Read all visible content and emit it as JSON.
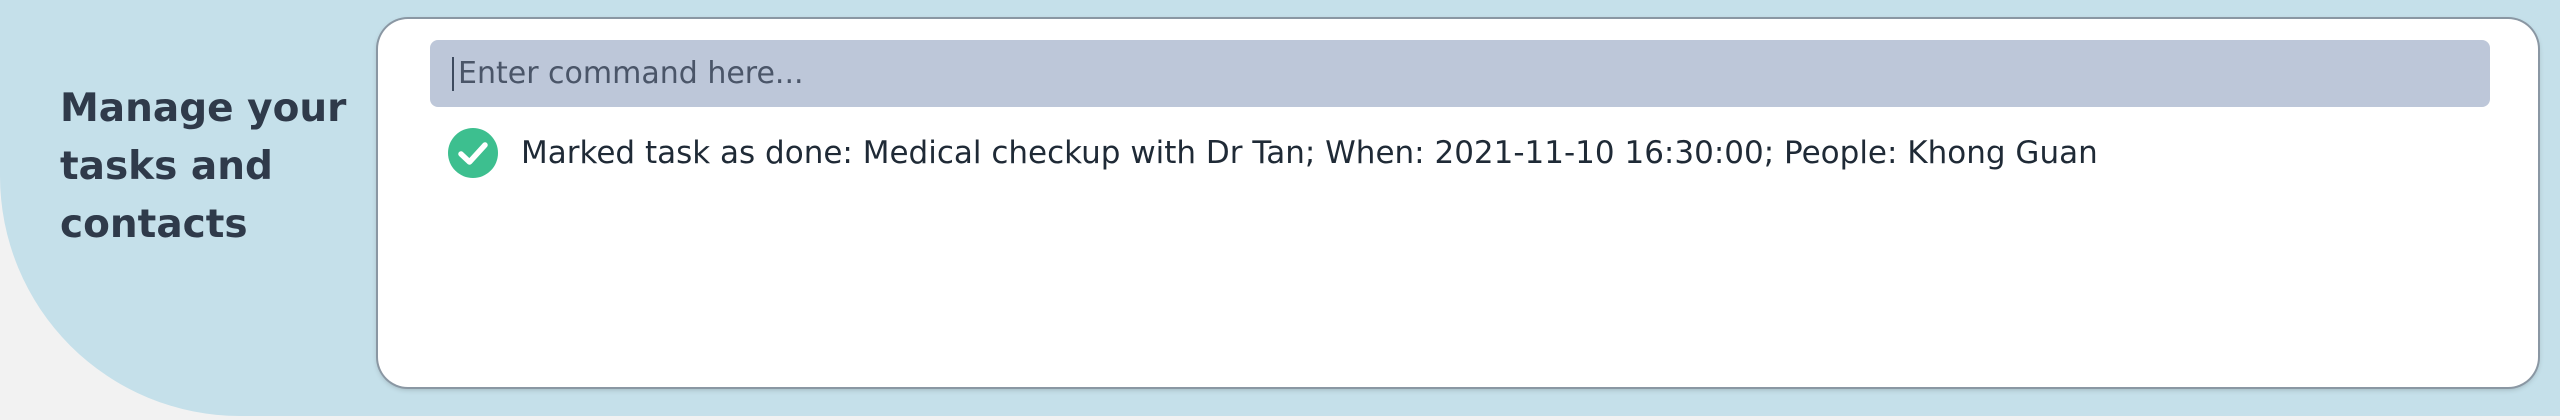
{
  "sidebar": {
    "tagline": "Manage your tasks and contacts"
  },
  "command": {
    "placeholder": "Enter command here...",
    "value": ""
  },
  "result": {
    "status_icon": "check-circle-icon",
    "message": "Marked task as done: Medical checkup with Dr Tan; When: 2021-11-10 16:30:00; People: Khong Guan"
  },
  "colors": {
    "background_panel": "#c5e0ea",
    "command_box": "#bdc7d9",
    "success": "#3dbf8f"
  }
}
